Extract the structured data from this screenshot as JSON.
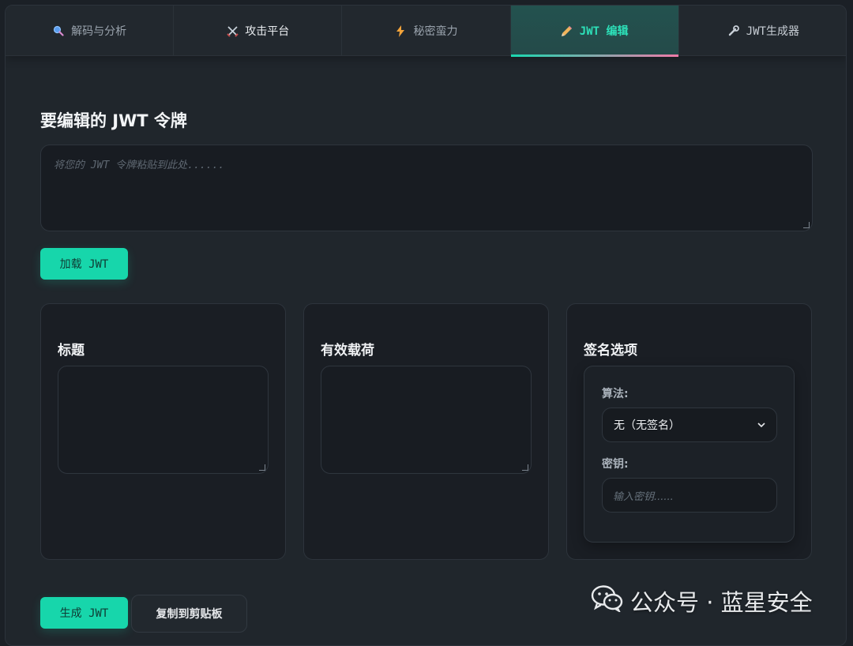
{
  "tabs": [
    {
      "icon": "magnifier-icon",
      "label": "解码与分析"
    },
    {
      "icon": "crossed-swords-icon",
      "label": "攻击平台"
    },
    {
      "icon": "lightning-icon",
      "label": "秘密蛮力"
    },
    {
      "icon": "pencil-icon",
      "label": "JWT 编辑"
    },
    {
      "icon": "wrench-icon",
      "label": "JWT生成器"
    }
  ],
  "active_tab": 3,
  "editor": {
    "title": "要编辑的 JWT 令牌",
    "input_placeholder": "将您的 JWT 令牌粘贴到此处......",
    "load_button": "加载 JWT"
  },
  "panels": {
    "header_title": "标题",
    "payload_title": "有效载荷",
    "signature_title": "签名选项",
    "algorithm_label": "算法:",
    "algorithm_value": "无（无签名）",
    "secret_label": "密钥:",
    "secret_placeholder": "输入密钥......"
  },
  "actions": {
    "generate_button": "生成 JWT",
    "copy_button": "复制到剪贴板"
  },
  "watermark": {
    "text": "公众号 · 蓝星安全"
  },
  "colors": {
    "accent": "#17d6ab",
    "accent_gradient_end": "#f07aa8",
    "background": "#20262c"
  }
}
